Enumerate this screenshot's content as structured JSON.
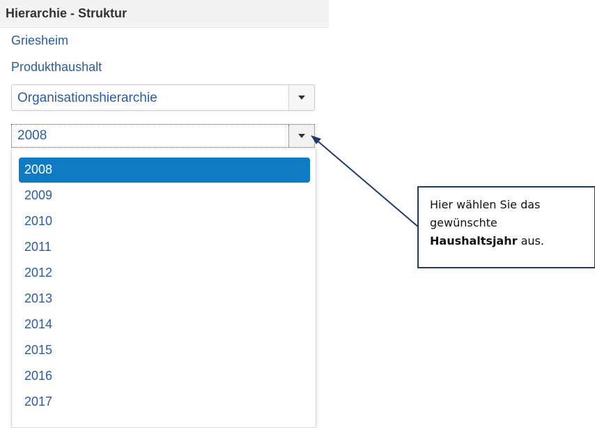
{
  "header": {
    "title": "Hierarchie - Struktur"
  },
  "links": {
    "location": "Griesheim",
    "budget": "Produkthaushalt"
  },
  "hierarchy_select": {
    "value": "Organisationshierarchie"
  },
  "year_select": {
    "value": "2008",
    "options": [
      "2008",
      "2009",
      "2010",
      "2011",
      "2012",
      "2013",
      "2014",
      "2015",
      "2016",
      "2017"
    ],
    "selected_index": 0
  },
  "callout": {
    "line1": "Hier wählen Sie das",
    "line2": "gewünschte",
    "bold": "Haushaltsjahr",
    "after_bold": " aus."
  },
  "colors": {
    "link": "#2a5d9f",
    "selected_bg": "#0e7bc3",
    "callout_border": "#1f3a68"
  }
}
